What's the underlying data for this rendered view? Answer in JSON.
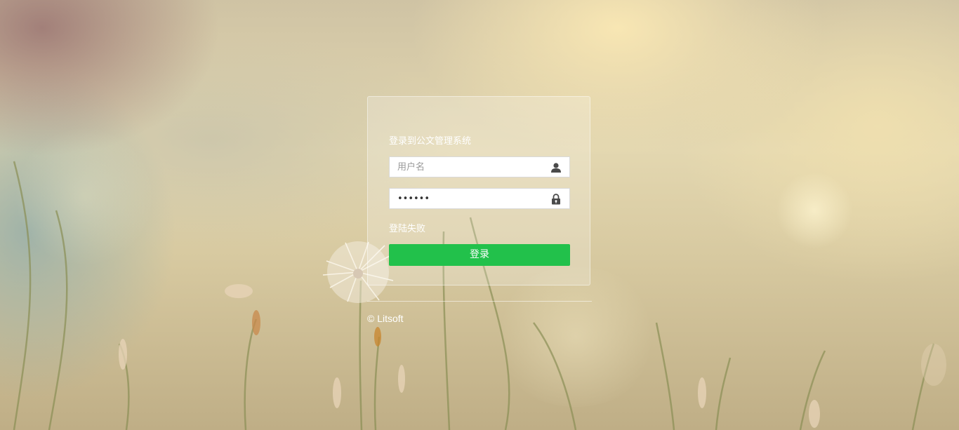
{
  "login": {
    "title": "登录到公文管理系统",
    "username": {
      "placeholder": "用户名",
      "value": "",
      "icon": "user-icon"
    },
    "password": {
      "placeholder": "",
      "value": "123456",
      "icon": "lock-icon"
    },
    "error_message": "登陆失败",
    "submit_label": "登录"
  },
  "footer": {
    "copyright": "© Litsoft"
  },
  "colors": {
    "button": "#22c14b",
    "text": "#ffffff"
  }
}
